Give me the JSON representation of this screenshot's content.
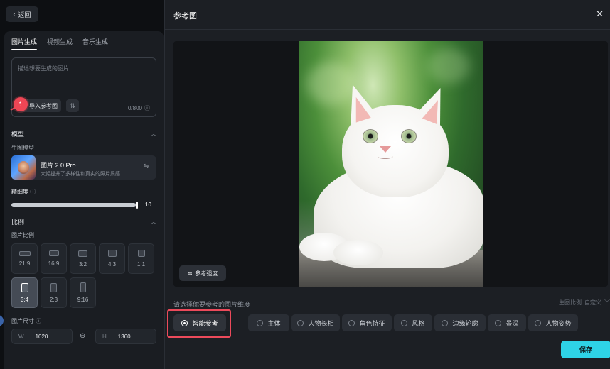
{
  "left_panel": {
    "back_label": "返回",
    "tabs": [
      {
        "label": "图片生成",
        "active": true
      },
      {
        "label": "视频生成",
        "active": false
      },
      {
        "label": "音乐生成",
        "active": false
      }
    ],
    "prompt": {
      "placeholder": "描述想要生成的图片",
      "ref_button_label": "导入参考图",
      "step_badge": "1",
      "char_count": "0/800"
    },
    "model_section": {
      "title": "模型",
      "sub_label": "生图模型",
      "model_name": "图片 2.0 Pro",
      "model_desc": "大幅提升了多样性和真实的照片质感...",
      "precision_label": "精细度",
      "precision_value": "10",
      "precision_max": 10
    },
    "ratio_section": {
      "title": "比例",
      "sub_label": "图片比例",
      "ratios": [
        {
          "label": "21:9",
          "selected": false
        },
        {
          "label": "16:9",
          "selected": false
        },
        {
          "label": "3:2",
          "selected": false
        },
        {
          "label": "4:3",
          "selected": false
        },
        {
          "label": "1:1",
          "selected": false
        },
        {
          "label": "3:4",
          "selected": true
        },
        {
          "label": "2:3",
          "selected": false
        },
        {
          "label": "9:16",
          "selected": false
        }
      ],
      "size_label": "图片尺寸",
      "width_label": "W",
      "width_value": "1020",
      "height_label": "H",
      "height_value": "1360"
    }
  },
  "modal": {
    "title": "参考图",
    "strength_button": "参考强度",
    "dims_prompt": "请选择你要参考的图片维度",
    "ratio_hint_label": "生图比例",
    "ratio_hint_value": "自定义",
    "options": [
      {
        "label": "智能参考",
        "selected": true
      },
      {
        "label": "主体",
        "selected": false
      },
      {
        "label": "人物长相",
        "selected": false
      },
      {
        "label": "角色特征",
        "selected": false
      },
      {
        "label": "风格",
        "selected": false
      },
      {
        "label": "边缘轮廓",
        "selected": false
      },
      {
        "label": "景深",
        "selected": false
      },
      {
        "label": "人物姿势",
        "selected": false
      }
    ],
    "save_button": "保存"
  },
  "colors": {
    "accent": "#2ed3e6",
    "highlight": "#ec4a5b",
    "panel": "#1a1d22",
    "modal": "#1c1f24"
  }
}
